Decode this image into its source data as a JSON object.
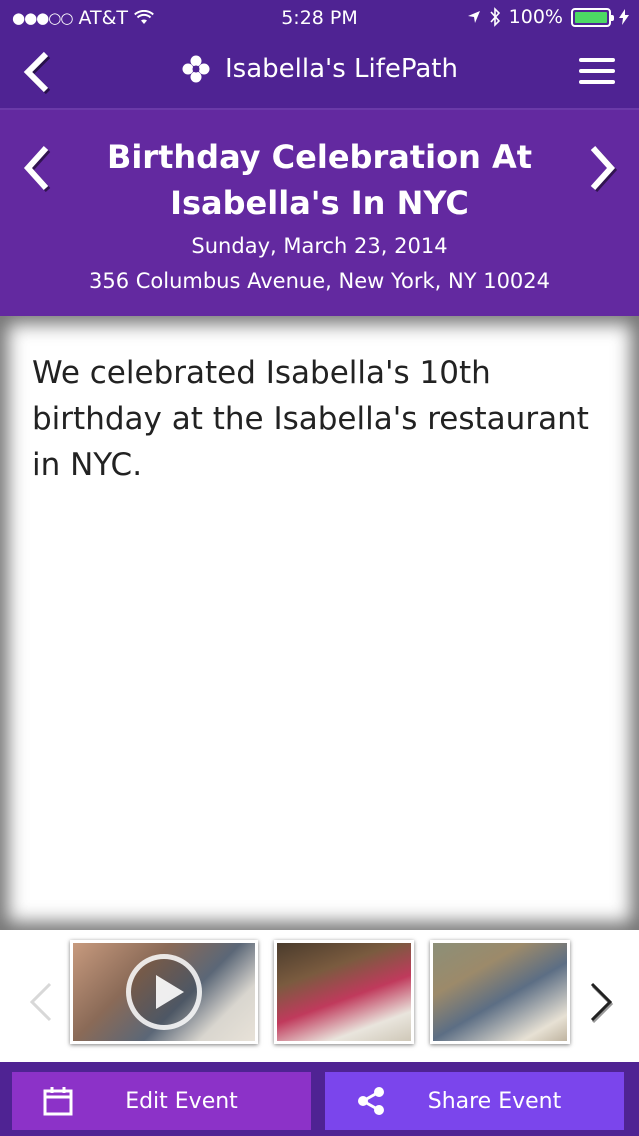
{
  "status_bar": {
    "carrier": "AT&T",
    "time": "5:28 PM",
    "battery": "100%",
    "signal_dots": "●●●○○",
    "battery_color": "#4cd964"
  },
  "nav": {
    "app_title": "Isabella's LifePath",
    "back_icon": "chevron-left-icon",
    "menu_icon": "hamburger-menu-icon",
    "logo_icon": "flower-logo-icon"
  },
  "event": {
    "title": "Birthday Celebration At Isabella's In NYC",
    "date": "Sunday, March 23, 2014",
    "address": "356 Columbus Avenue, New York, NY 10024",
    "description": "We celebrated Isabella's 10th birthday at the Isabella's restaurant in NYC."
  },
  "media": {
    "items": [
      {
        "type": "video",
        "name": "video-thumbnail"
      },
      {
        "type": "photo",
        "name": "photo-thumbnail"
      },
      {
        "type": "photo",
        "name": "photo-thumbnail"
      }
    ]
  },
  "actions": {
    "edit_label": "Edit Event",
    "share_label": "Share Event",
    "edit_icon": "calendar-icon",
    "share_icon": "share-icon"
  },
  "colors": {
    "nav_bg": "#4f2393",
    "header_bg": "#6329a0",
    "edit_button": "#8c32c8",
    "share_button": "#7b45ec"
  }
}
